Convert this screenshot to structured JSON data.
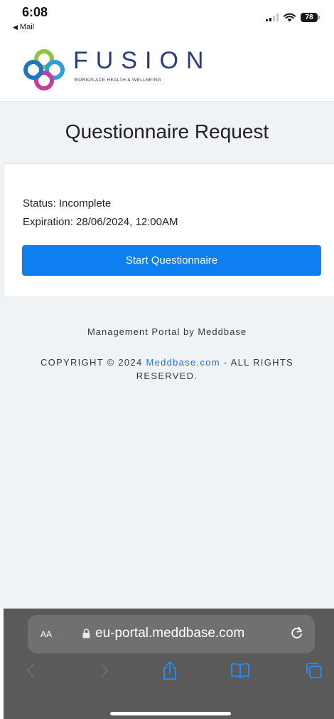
{
  "status_bar": {
    "time": "6:08",
    "back_app": "Mail",
    "battery": "78"
  },
  "header": {
    "logo_word": "FUSION",
    "logo_tagline": "WORKPLACE HEALTH & WELLBEING"
  },
  "main": {
    "title": "Questionnaire Request",
    "status_text": "Status: Incomplete",
    "expiration_text": "Expiration: 28/06/2024, 12:00AM",
    "start_button_label": "Start Questionnaire"
  },
  "footer": {
    "portal_text": "Management Portal by Meddbase",
    "copyright_prefix": "COPYRIGHT © 2024 ",
    "copyright_link": "Meddbase.com",
    "copyright_suffix": " - ALL RIGHTS RESERVED."
  },
  "browser": {
    "aa_label": "AA",
    "url": "eu-portal.meddbase.com",
    "icons": [
      "lock-icon",
      "reload-icon",
      "back-icon",
      "forward-icon",
      "share-icon",
      "bookmarks-icon",
      "tabs-icon"
    ]
  },
  "colors": {
    "accent": "#0d7ff0",
    "link": "#1f6fd6",
    "logo_text": "#2a3c7c",
    "page_bg": "#f0f3f5",
    "browser_bar": "#5a5a5a"
  }
}
